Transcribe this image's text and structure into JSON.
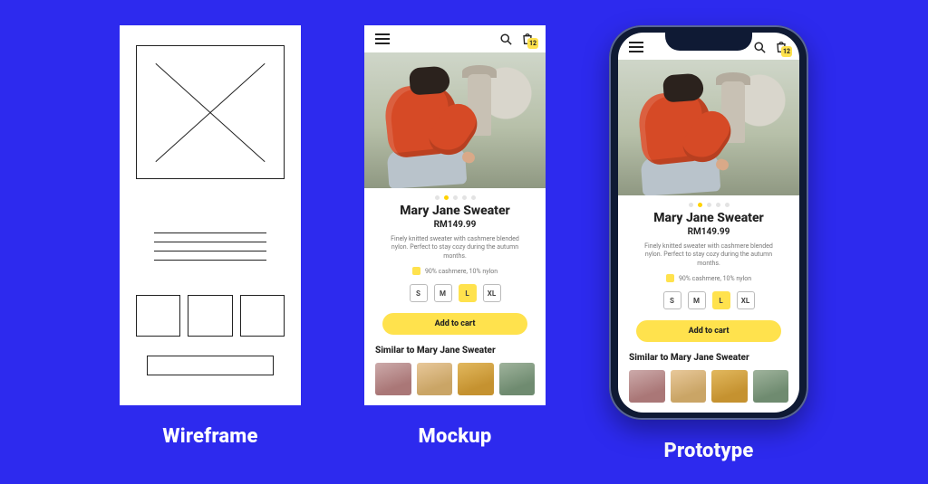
{
  "captions": {
    "wireframe": "Wireframe",
    "mockup": "Mockup",
    "prototype": "Prototype"
  },
  "product": {
    "title": "Mary Jane Sweater",
    "price": "RM149.99",
    "description": "Finely knitted sweater with cashmere blended nylon. Perfect to stay cozy during the autumn months.",
    "material": "90% cashmere, 10% nylon",
    "sizes": [
      "S",
      "M",
      "L",
      "XL"
    ],
    "selected_size": "L",
    "cta": "Add to cart",
    "similar_heading": "Similar to Mary Jane Sweater",
    "cart_badge": "12"
  },
  "colors": {
    "accent": "#ffe24d",
    "bg": "#2d2aee",
    "ink": "#222222"
  }
}
